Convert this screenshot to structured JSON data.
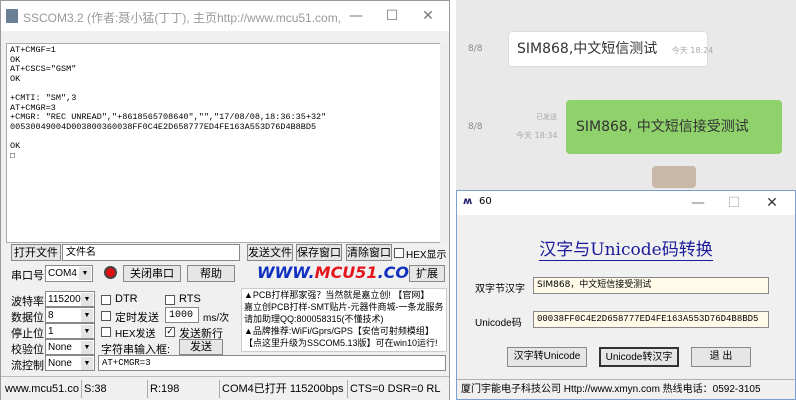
{
  "sscom": {
    "title": "SSCOM3.2 (作者:聂小猛(丁丁), 主页http://www.mcu51.com,  E...",
    "window_controls": {
      "minimize": "—",
      "maximize": "☐",
      "close": "✕"
    },
    "terminal_lines": [
      "AT+CMGF=1",
      "OK",
      "AT+CSCS=\"GSM\"",
      "OK",
      "",
      "+CMTI: \"SM\",3",
      "AT+CMGR=3",
      "+CMGR: \"REC UNREAD\",\"+8618565708640\",\"\",\"17/08/08,18:36:35+32\"",
      "00530049004D003800360038FF0C4E2D658777ED4FE163A553D76D4B8BD5",
      "",
      "OK",
      "□"
    ],
    "row1": {
      "open_file": "打开文件",
      "file_name": "文件名",
      "send_file": "发送文件",
      "save_window": "保存窗口",
      "clear_window": "清除窗口",
      "hex_display": "HEX显示"
    },
    "row2": {
      "port_label": "串口号",
      "port_value": "COM4",
      "close_port": "关闭串口",
      "help": "帮助",
      "brand_prefix": "WWW.",
      "brand_mid": "MCU51",
      "brand_suffix": ".COM",
      "expand": "扩展"
    },
    "settings": {
      "baud_label": "波特率",
      "baud_value": "115200",
      "databits_label": "数据位",
      "databits_value": "8",
      "stopbits_label": "停止位",
      "stopbits_value": "1",
      "parity_label": "校验位",
      "parity_value": "None",
      "flow_label": "流控制",
      "flow_value": "None"
    },
    "checks": {
      "dtr": "DTR",
      "rts": "RTS",
      "timed_send": "定时发送",
      "interval": "1000",
      "interval_unit": "ms/次",
      "hex_send": "HEX发送",
      "send_newline": "发送新行",
      "send_button": "发送",
      "input_label": "字符串输入框:",
      "input_value": "AT+CMGR=3"
    },
    "ads": [
      "▲PCB打样那家强？当然就是嘉立创! 【官网】",
      "嘉立创PCB打样-SMT贴片-元器件商城-一条龙服务",
      "请加助理QQ:800058315(不懂技术)",
      "▲品牌推荐:WiFi/Gprs/GPS【安信可射频模组】",
      "【点这里升级为SSCOM5.13版】可在win10运行!"
    ],
    "status": {
      "url": "www.mcu51.cor",
      "sent": "S:38",
      "recv": "R:198",
      "port_status": "COM4已打开  115200bps",
      "lines": "CTS=0 DSR=0 RL"
    }
  },
  "chat": {
    "date1": "8/8",
    "msg1": "SIM868,中文短信测试",
    "time1": "今天 18:24",
    "date2": "8/8",
    "read_label": "已发送",
    "time2": "今天 18:34",
    "msg2": "SIM868, 中文短信接受测试"
  },
  "unicode_tool": {
    "title": "60",
    "window_controls": {
      "minimize": "—",
      "maximize": "☐",
      "close": "✕"
    },
    "heading": "汉字与Unicode码转换",
    "hanzi_label": "双字节汉字",
    "hanzi_value": "SIM868，中文短信接受测试",
    "unicode_label": "Unicode码",
    "unicode_value": "00038FF0C4E2D658777ED4FE163A553D76D4B8BD5",
    "btn_to_unicode": "汉字转Unicode",
    "btn_to_hanzi": "Unicode转汉字",
    "btn_exit": "退  出",
    "footer": "厦门宇能电子科技公司  Http://www.xmyn.com  热线电话：0592-3105"
  },
  "colors": {
    "brand_red": "#e4151b",
    "brand_blue": "#1030c0",
    "bubble_green": "#8fd16a",
    "heading_blue": "#1a1a9a"
  }
}
